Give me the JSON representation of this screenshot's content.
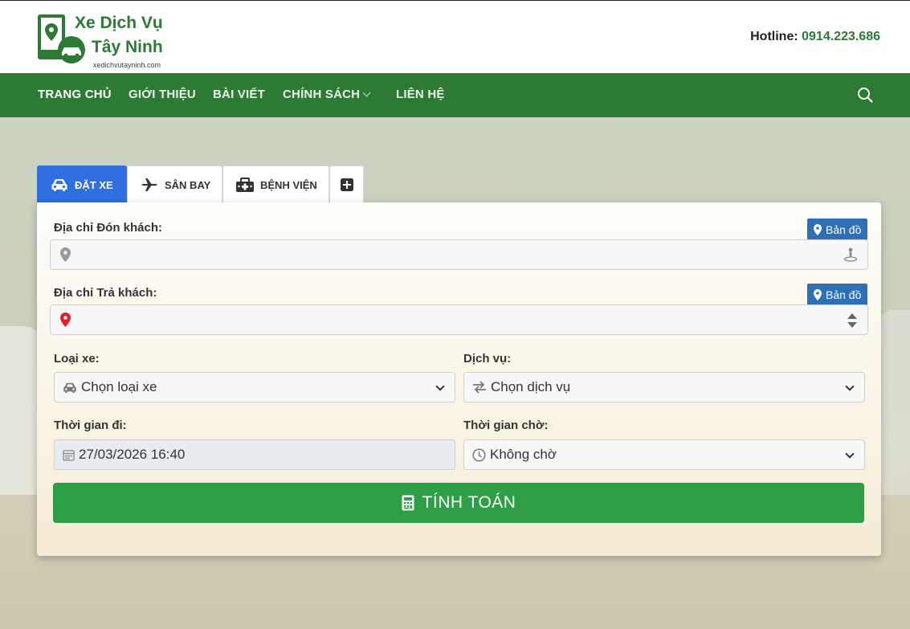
{
  "brand": {
    "title_line1": "Xe Dịch Vụ",
    "title_line2": "Tây Ninh",
    "url": "xedichvutayninh.com",
    "primary_color": "#2d7a34",
    "logo_icon": "map-pin-car-icon"
  },
  "header": {
    "hotline_label": "Hotline:",
    "hotline_number": "0914.223.686"
  },
  "nav": {
    "items": [
      {
        "label": "TRANG CHỦ"
      },
      {
        "label": "GIỚI THIỆU"
      },
      {
        "label": "BÀI VIẾT"
      },
      {
        "label": "CHÍNH SÁCH"
      },
      {
        "label": "LIÊN HỆ"
      }
    ],
    "search_icon": "search-icon"
  },
  "tabs": [
    {
      "label": "ĐẶT XE",
      "icon": "car-icon",
      "active": true
    },
    {
      "label": "SÂN BAY",
      "icon": "plane-icon",
      "active": false
    },
    {
      "label": "BỆNH VIỆN",
      "icon": "hospital-icon",
      "active": false
    },
    {
      "label": "",
      "icon": "plus-square-icon",
      "active": false
    }
  ],
  "form": {
    "pickup": {
      "label": "Địa chỉ Đón khách:",
      "map_button": "Bản đồ",
      "value": ""
    },
    "dropoff": {
      "label": "Địa chỉ Trả khách:",
      "map_button": "Bản đồ",
      "value": ""
    },
    "vehicle": {
      "label": "Loại xe:",
      "selected": "Chọn loại xe"
    },
    "service": {
      "label": "Dịch vụ:",
      "selected": "Chọn dịch vụ"
    },
    "depart_time": {
      "label": "Thời gian đi:",
      "value": "27/03/2026 16:40"
    },
    "wait_time": {
      "label": "Thời gian chờ:",
      "selected": "Không chờ"
    },
    "calculate_button": "TÍNH TOÁN"
  },
  "colors": {
    "active_tab": "#2f6fe0",
    "map_button": "#2e6fb6",
    "calc_button": "#2e9e47",
    "dropoff_pin": "#e0202a"
  }
}
